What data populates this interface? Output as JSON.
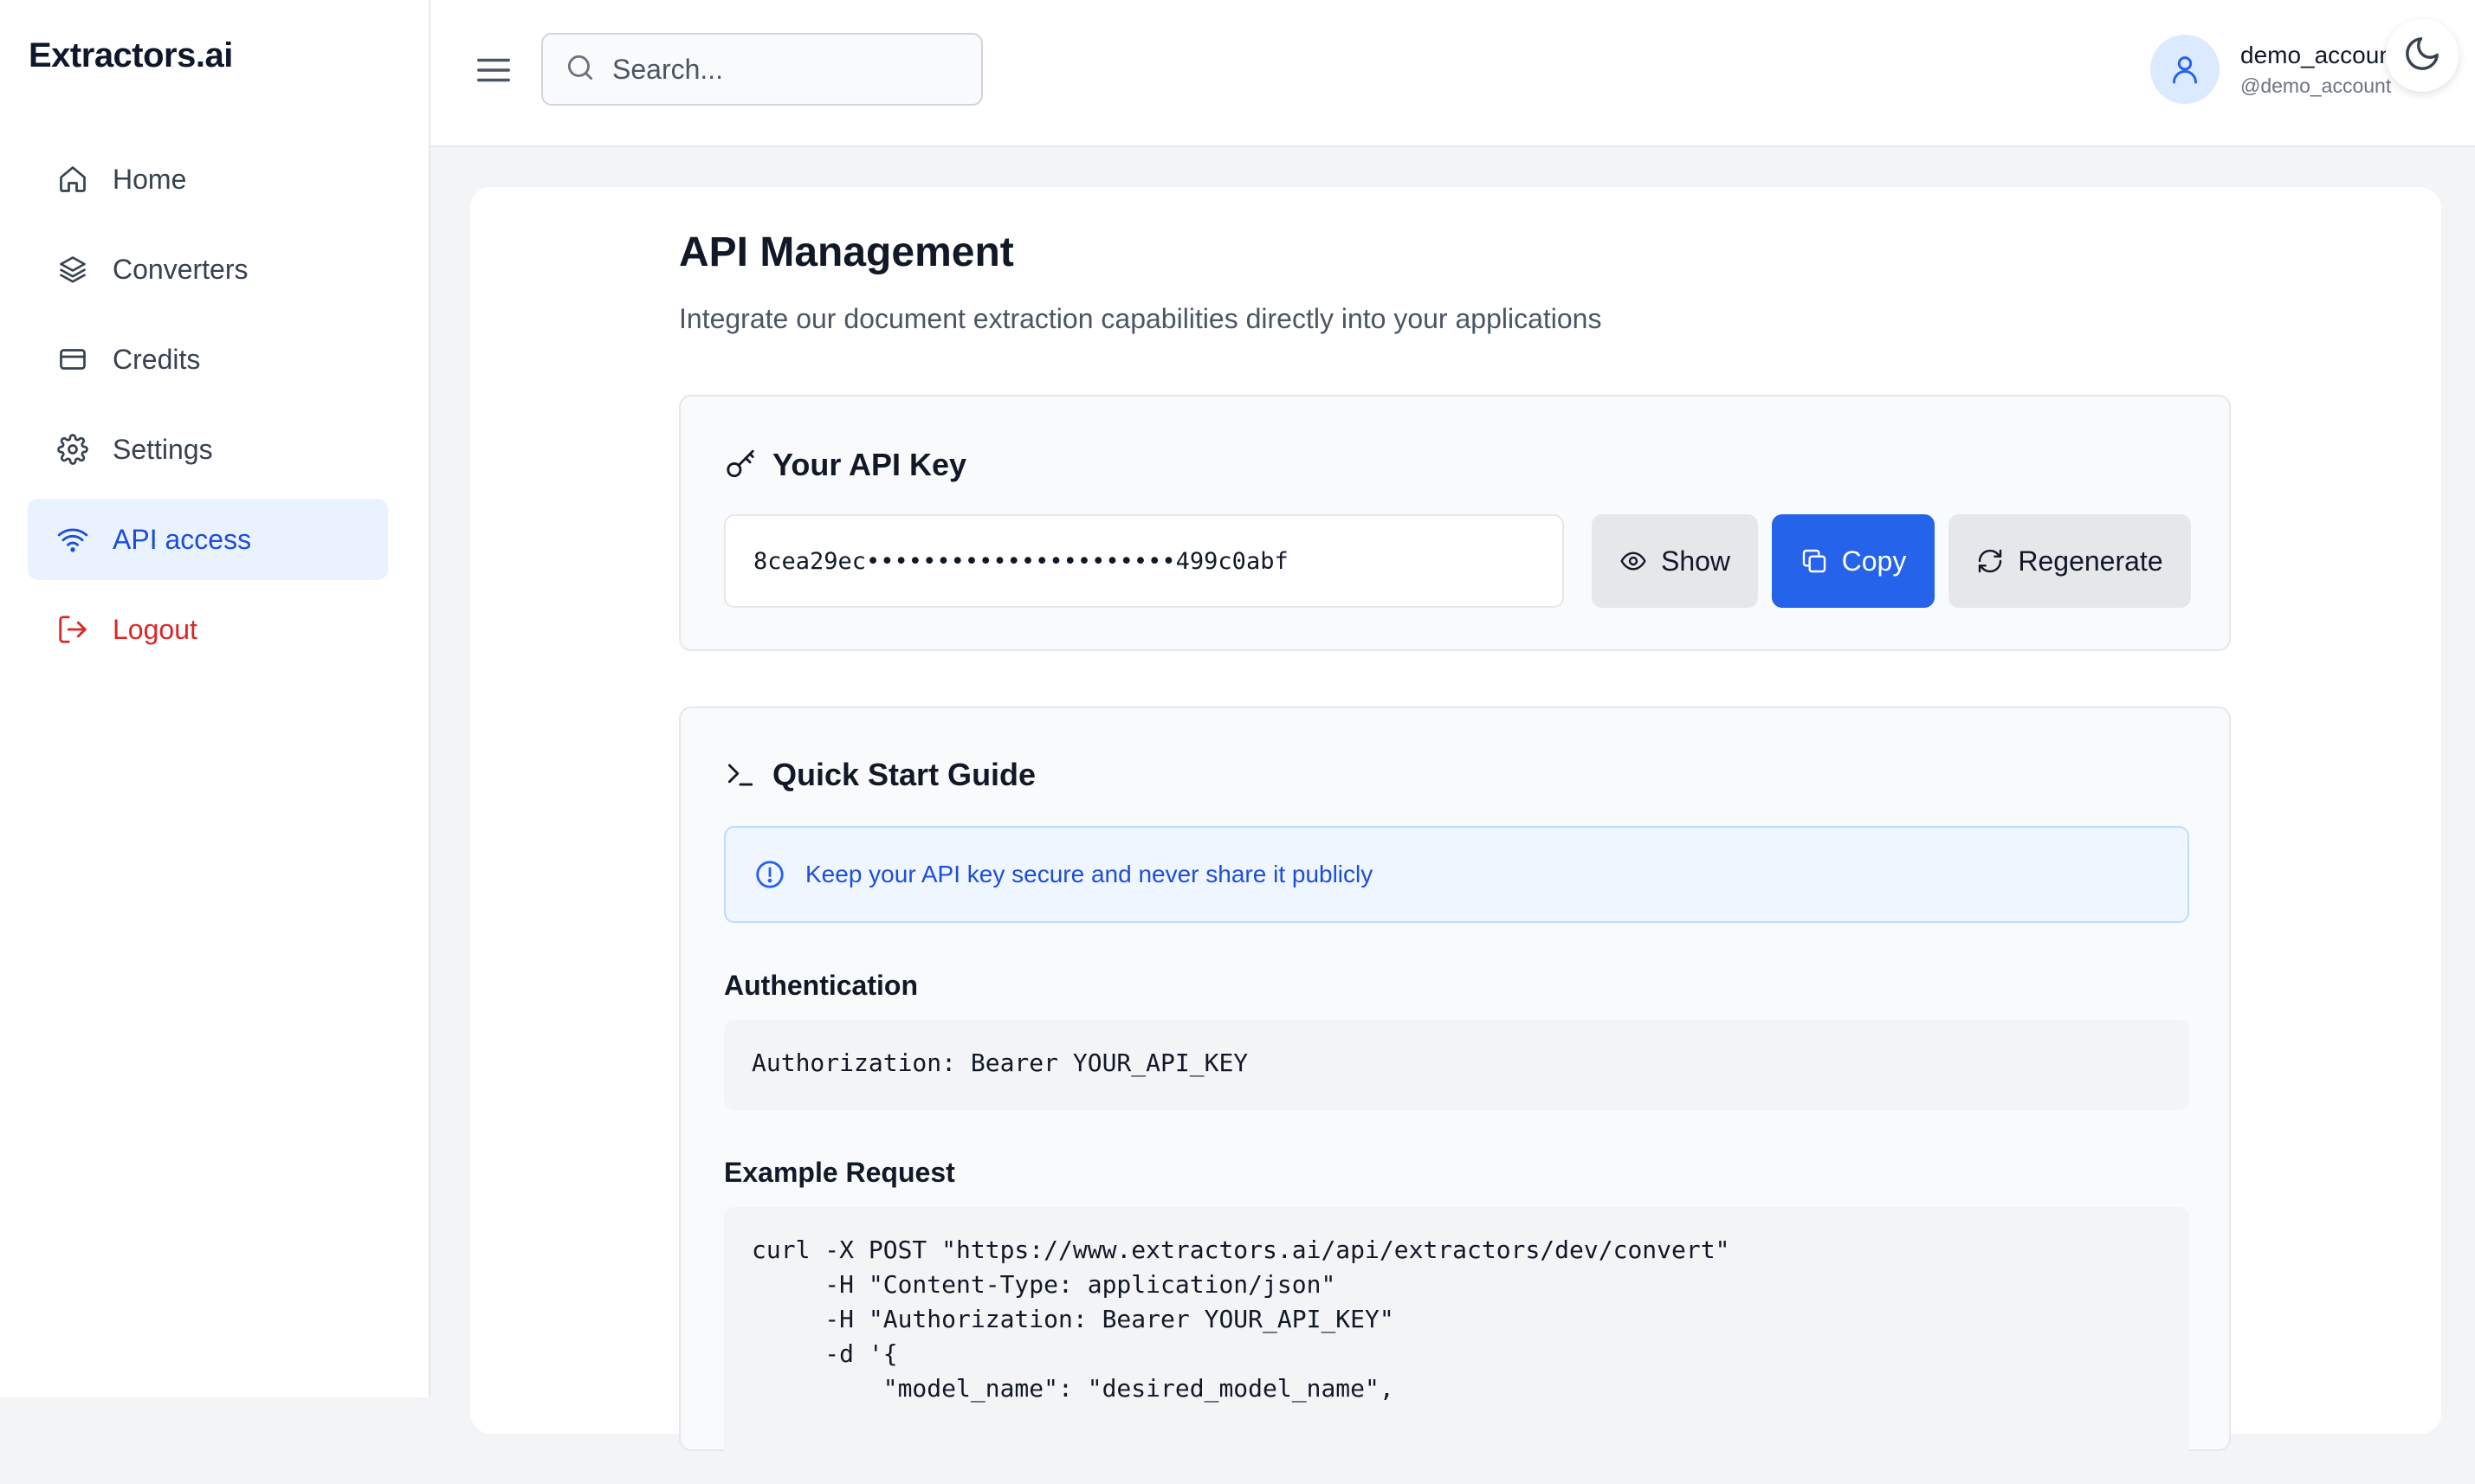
{
  "brand": "Extractors.ai",
  "sidebar": {
    "items": [
      {
        "label": "Home",
        "icon": "home-icon"
      },
      {
        "label": "Converters",
        "icon": "layers-icon"
      },
      {
        "label": "Credits",
        "icon": "credit-card-icon"
      },
      {
        "label": "Settings",
        "icon": "gear-icon"
      },
      {
        "label": "API access",
        "icon": "wifi-icon",
        "active": true
      },
      {
        "label": "Logout",
        "icon": "logout-icon"
      }
    ]
  },
  "header": {
    "search_placeholder": "Search...",
    "user_name": "demo_account",
    "user_handle": "@demo_account"
  },
  "page": {
    "title": "API Management",
    "subtitle": "Integrate our document extraction capabilities directly into your applications"
  },
  "api_key": {
    "heading": "Your API Key",
    "masked_value": "8cea29ec••••••••••••••••••••••499c0abf",
    "show_label": "Show",
    "copy_label": "Copy",
    "regenerate_label": "Regenerate"
  },
  "guide": {
    "heading": "Quick Start Guide",
    "alert": "Keep your API key secure and never share it publicly",
    "auth_label": "Authentication",
    "auth_code": "Authorization: Bearer YOUR_API_KEY",
    "example_label": "Example Request",
    "example_code": "curl -X POST \"https://www.extractors.ai/api/extractors/dev/convert\"\n     -H \"Content-Type: application/json\"\n     -H \"Authorization: Bearer YOUR_API_KEY\"\n     -d '{\n         \"model_name\": \"desired_model_name\","
  },
  "colors": {
    "accent": "#2563eb",
    "active_bg": "#eaf2fd",
    "danger": "#dc2626",
    "alert_bg": "#eff6ff"
  }
}
